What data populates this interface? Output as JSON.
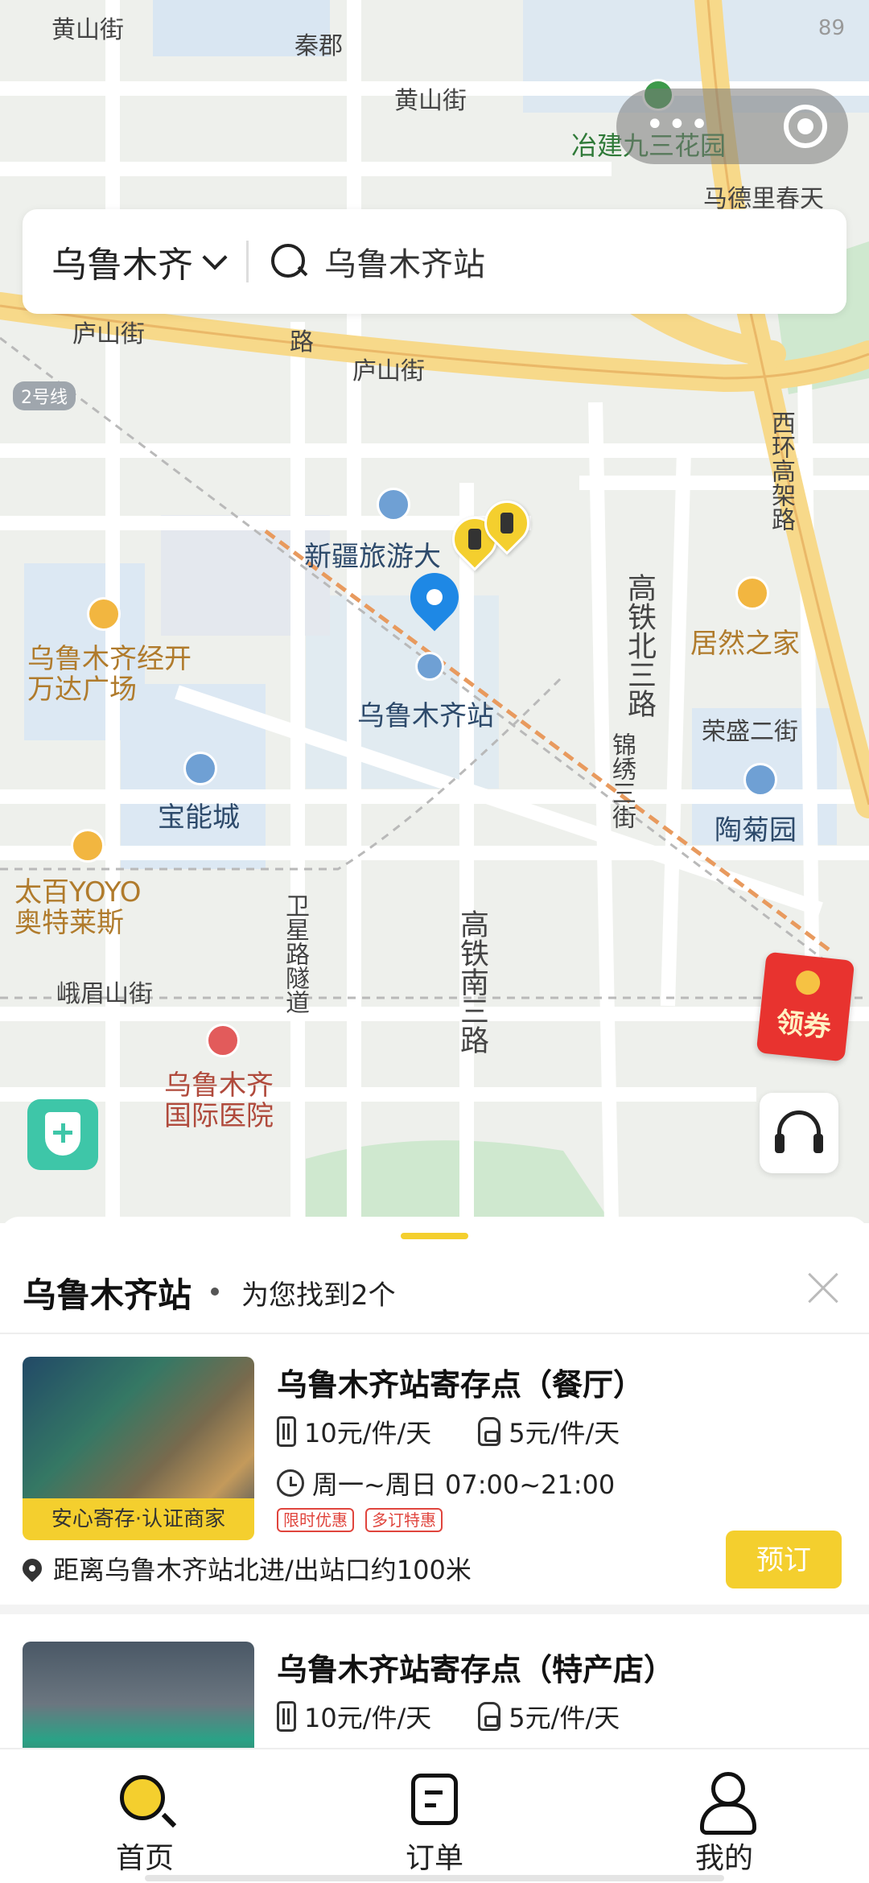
{
  "status_bar": {
    "battery": "89"
  },
  "map": {
    "labels": {
      "huangshan_jie_1": "黄山街",
      "qinjun": "秦郡",
      "huangshan_jie_2": "黄山街",
      "yejian_park": "冶建九三花园",
      "madeli": "马德里春天",
      "lushan_jie_1": "庐山街",
      "lushan_jie_2": "庐山街",
      "metro_line2": "2号线",
      "lu": "路",
      "xinjiang_tourism": "新疆旅游大",
      "urumqi_station": "乌鲁木齐站",
      "gaotie_north": "高铁北三路",
      "jurzhijia": "居然之家",
      "rongsheng": "荣盛二街",
      "jinxiu": "锦绣三街",
      "taojuyuan": "陶菊园",
      "wanda": "乌鲁木齐经开万达广场",
      "baoneng": "宝能城",
      "taibai": "太百YOYO奥特莱斯",
      "weixing": "卫星路隧道",
      "gaotie_south": "高铁南三路",
      "emeishan": "峨眉山街",
      "hospital": "乌鲁木齐国际医院",
      "xihuan": "西环高架路"
    },
    "coupon_label": "领券"
  },
  "search": {
    "city": "乌鲁木齐",
    "query": "乌鲁木齐站"
  },
  "sheet": {
    "title": "乌鲁木齐站",
    "count_text": "为您找到2个",
    "results": [
      {
        "name": "乌鲁木齐站寄存点（餐厅）",
        "trust_tag": "安心寄存·认证商家",
        "price_large": "10元/件/天",
        "price_small": "5元/件/天",
        "hours": "周一~周日 07:00~21:00",
        "tags": [
          "限时优惠",
          "多订特惠"
        ],
        "distance": "距离乌鲁木齐站北进/出站口约100米",
        "book_label": "预订"
      },
      {
        "name": "乌鲁木齐站寄存点（特产店）",
        "price_large": "10元/件/天",
        "price_small": "5元/件/天"
      }
    ]
  },
  "tabbar": {
    "home": "首页",
    "orders": "订单",
    "mine": "我的"
  },
  "colors": {
    "accent": "#f4cf2e",
    "pin_blue": "#1e88e5",
    "promo_red": "#e0453d",
    "shield_green": "#3ec6a8"
  }
}
